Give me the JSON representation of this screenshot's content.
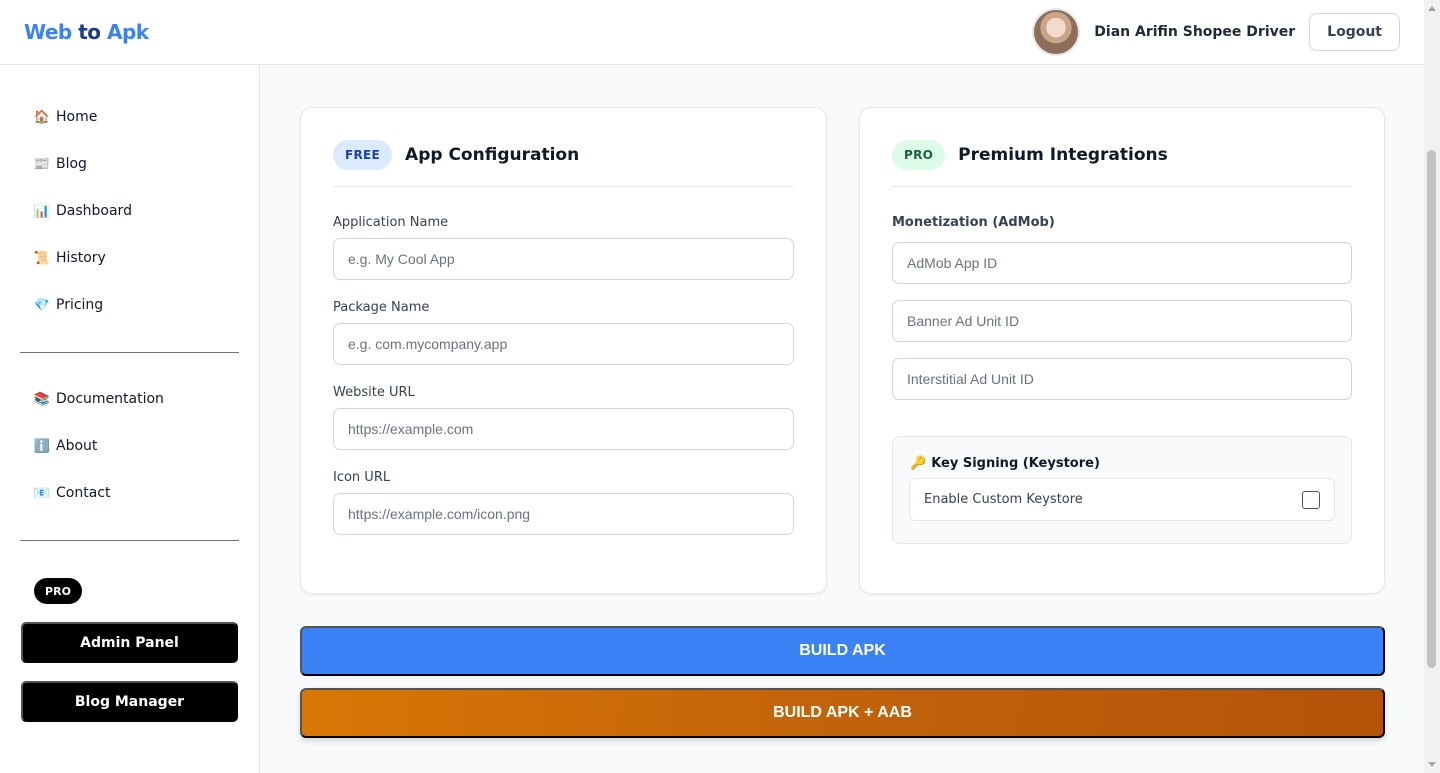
{
  "brand": {
    "part1": "Web",
    "part2": "to",
    "part3": "Apk"
  },
  "header": {
    "user_name": "Dian Arifin Shopee Driver",
    "logout_label": "Logout"
  },
  "sidebar": {
    "items": [
      {
        "label": "Home",
        "icon": "🏠"
      },
      {
        "label": "Blog",
        "icon": "📰"
      },
      {
        "label": "Dashboard",
        "icon": "📊"
      },
      {
        "label": "History",
        "icon": "📜"
      },
      {
        "label": "Pricing",
        "icon": "💎"
      }
    ],
    "items2": [
      {
        "label": "Documentation",
        "icon": "📚"
      },
      {
        "label": "About",
        "icon": "ℹ️"
      },
      {
        "label": "Contact",
        "icon": "📧"
      }
    ],
    "pro_badge": "PRO",
    "admin_panel": "Admin Panel",
    "blog_manager": "Blog Manager"
  },
  "config_card": {
    "badge": "FREE",
    "title": "App Configuration",
    "fields": [
      {
        "label": "Application Name",
        "placeholder": "e.g. My Cool App",
        "value": ""
      },
      {
        "label": "Package Name",
        "placeholder": "e.g. com.mycompany.app",
        "value": ""
      },
      {
        "label": "Website URL",
        "placeholder": "https://example.com",
        "value": ""
      },
      {
        "label": "Icon URL",
        "placeholder": "https://example.com/icon.png",
        "value": ""
      }
    ]
  },
  "premium_card": {
    "badge": "PRO",
    "title": "Premium Integrations",
    "monetization_label": "Monetization (AdMob)",
    "fields": [
      {
        "placeholder": "AdMob App ID",
        "value": ""
      },
      {
        "placeholder": "Banner Ad Unit ID",
        "value": ""
      },
      {
        "placeholder": "Interstitial Ad Unit ID",
        "value": ""
      }
    ],
    "keystore": {
      "icon": "🔑",
      "title": "Key Signing (Keystore)",
      "checkbox_label": "Enable Custom Keystore",
      "checked": false
    }
  },
  "actions": {
    "build_apk": "BUILD APK",
    "build_apk_aab": "BUILD APK + AAB"
  },
  "colors": {
    "accent": "#3b82f6",
    "orange": "#d97706",
    "black": "#000000"
  }
}
